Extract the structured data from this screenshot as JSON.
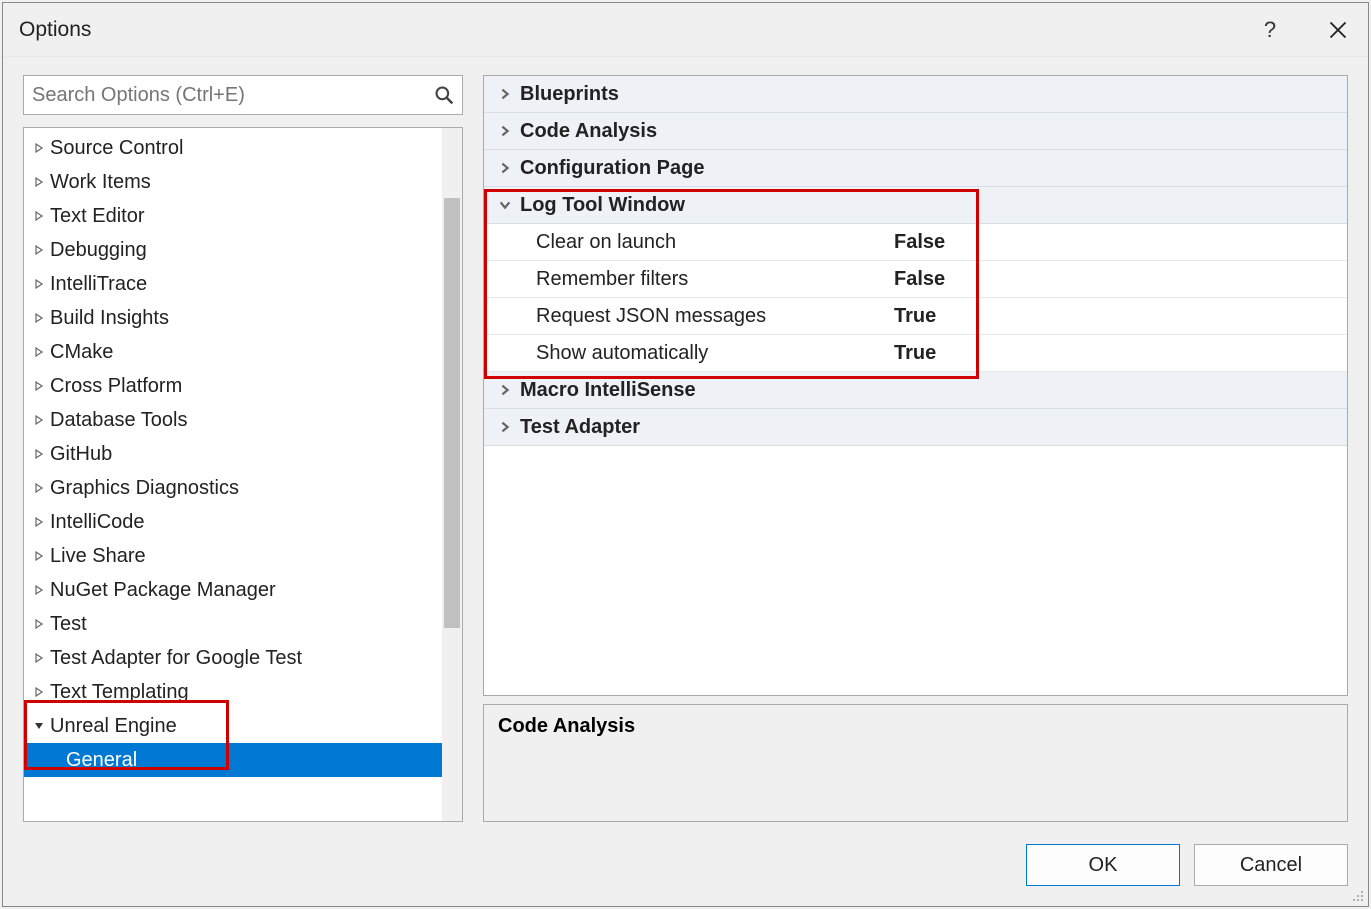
{
  "title": "Options",
  "search": {
    "placeholder": "Search Options (Ctrl+E)"
  },
  "tree": {
    "items": [
      "Source Control",
      "Work Items",
      "Text Editor",
      "Debugging",
      "IntelliTrace",
      "Build Insights",
      "CMake",
      "Cross Platform",
      "Database Tools",
      "GitHub",
      "Graphics Diagnostics",
      "IntelliCode",
      "Live Share",
      "NuGet Package Manager",
      "Test",
      "Test Adapter for Google Test",
      "Text Templating"
    ],
    "expanded": "Unreal Engine",
    "selected": "General"
  },
  "propgrid": {
    "sections": [
      {
        "label": "Blueprints",
        "expanded": false
      },
      {
        "label": "Code Analysis",
        "expanded": false
      },
      {
        "label": "Configuration Page",
        "expanded": false
      },
      {
        "label": "Log Tool Window",
        "expanded": true,
        "rows": [
          {
            "name": "Clear on launch",
            "value": "False"
          },
          {
            "name": "Remember filters",
            "value": "False"
          },
          {
            "name": "Request JSON messages",
            "value": "True"
          },
          {
            "name": "Show automatically",
            "value": "True"
          }
        ]
      },
      {
        "label": "Macro IntelliSense",
        "expanded": false
      },
      {
        "label": "Test Adapter",
        "expanded": false
      }
    ]
  },
  "description": {
    "title": "Code Analysis"
  },
  "buttons": {
    "ok": "OK",
    "cancel": "Cancel"
  }
}
